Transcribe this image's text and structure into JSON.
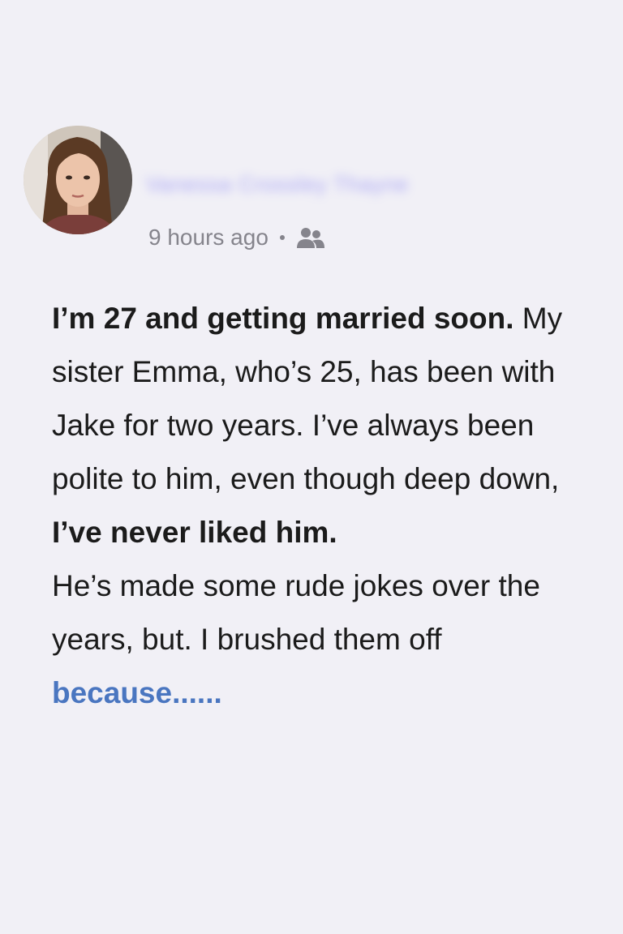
{
  "post": {
    "author_name": "Vanessa Crossley Thayne",
    "timestamp": "9 hours ago",
    "privacy_icon": "friends-icon",
    "avatar_icon": "avatar",
    "paragraph1": {
      "bold_lead": "I’m 27 and getting married soon.",
      "text_a": " My sister Emma, who’s 25, has been with Jake for two years. I’ve always been polite to him, even though deep down, ",
      "bold_tail": "I’ve never liked him."
    },
    "paragraph2": {
      "text": "He’s made some rude jokes over the years, but. I brushed them off ",
      "more_link": "because......"
    },
    "colors": {
      "background": "#f1f0f6",
      "link": "#4a76c0",
      "meta": "#85848c"
    }
  }
}
